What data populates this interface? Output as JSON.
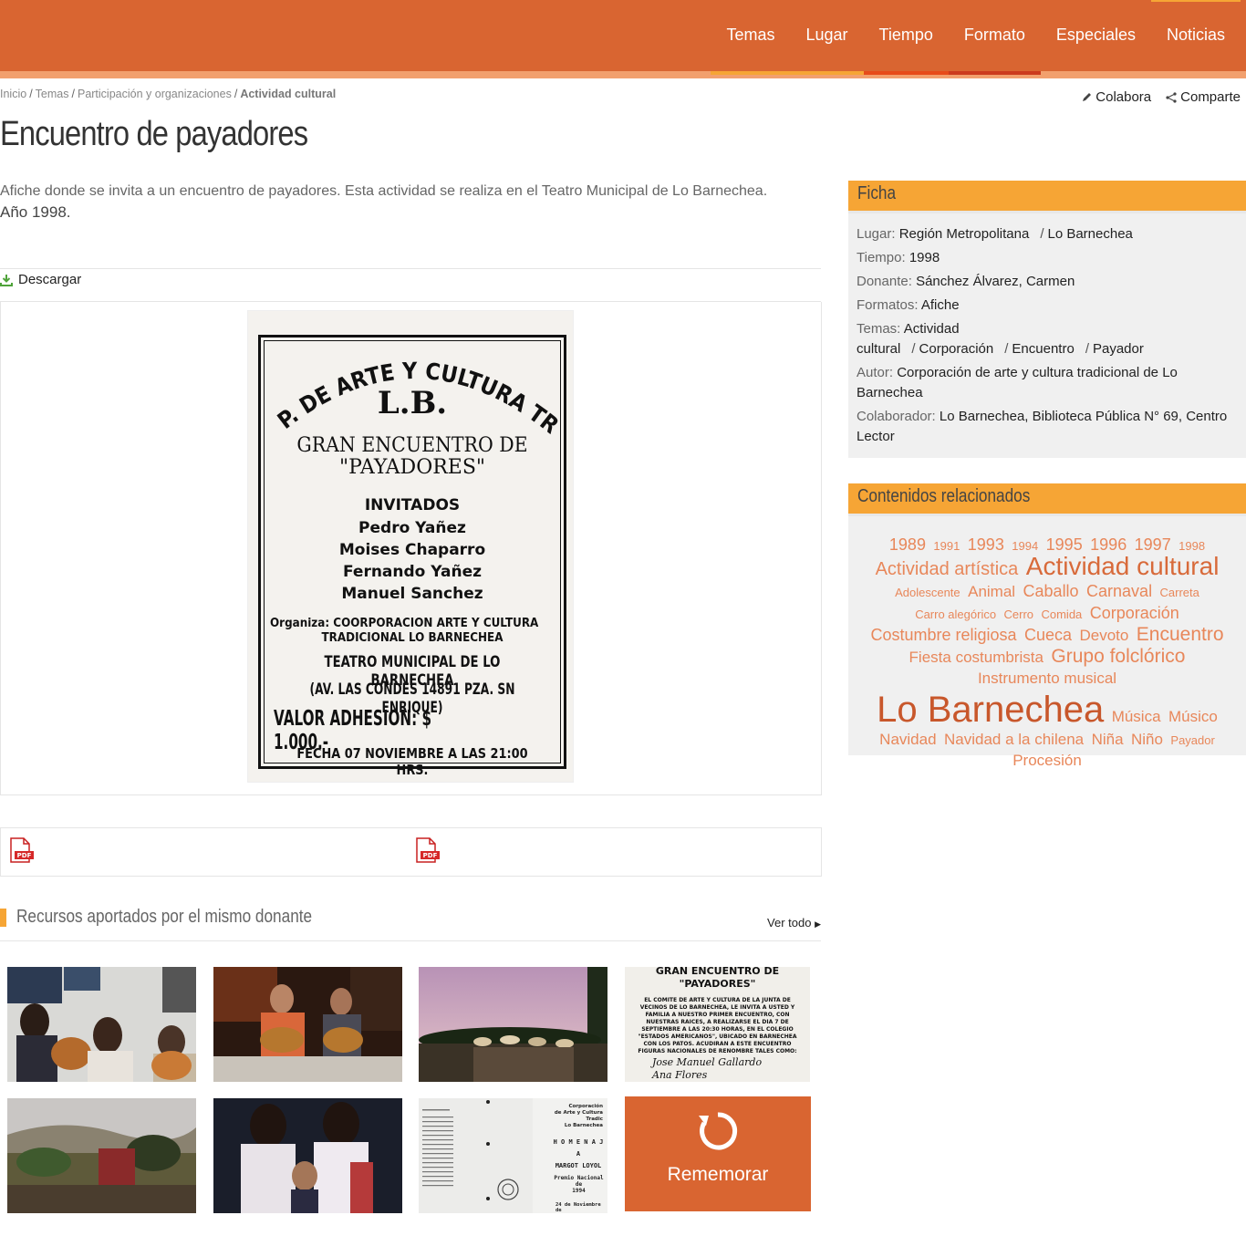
{
  "nav": {
    "items": [
      {
        "label": "Temas",
        "bar": "#f6a535"
      },
      {
        "label": "Lugar",
        "bar": "#f6a535"
      },
      {
        "label": "Tiempo",
        "bar": "#e74b1a"
      },
      {
        "label": "Formato",
        "bar": "#cc3b1e"
      },
      {
        "label": "Especiales",
        "bar": ""
      },
      {
        "label": "Noticias",
        "bar": ""
      }
    ]
  },
  "breadcrumb": {
    "items": [
      "Inicio",
      "Temas",
      "Participación y organizaciones"
    ],
    "current": "Actividad cultural"
  },
  "tools": {
    "collaborate": "Colabora",
    "share": "Comparte"
  },
  "page": {
    "title": "Encuentro de payadores",
    "description": "Afiche donde se invita a un encuentro de payadores. Esta actividad se realiza en el Teatro Municipal de Lo Barnechea.",
    "year": "Año 1998.",
    "download": "Descargar"
  },
  "poster": {
    "header": "CORP. DE ARTE Y CULTURA TRAD.",
    "lb": "L.B.",
    "title1": "GRAN ENCUENTRO DE",
    "title2": "\"PAYADORES\"",
    "guests_label": "INVITADOS",
    "guests": [
      "Pedro Yañez",
      "Moises Chaparro",
      "Fernando Yañez",
      "Manuel Sanchez"
    ],
    "organizer1": "Organiza: COORPORACION ARTE Y CULTURA",
    "organizer2": "TRADICIONAL LO BARNECHEA",
    "venue": "TEATRO MUNICIPAL DE LO BARNECHEA",
    "address": "(AV. LAS CONDES 14891 PZA. SN ENRIQUE)",
    "price": "VALOR ADHESION:  $ 1.000.-",
    "date": "FECHA 07 NOVIEMBRE A LAS 21:00 HRS."
  },
  "related_resources": {
    "title": "Recursos aportados por el mismo donante",
    "see_all": "Ver todo",
    "doc_thumb": {
      "title1": "GRAN ENCUENTRO DE",
      "title2": "\"PAYADORES\"",
      "body": "EL COMITE DE ARTE Y CULTURA DE LA JUNTA DE VECINOS DE LO BARNECHEA, LE INVITA A USTED Y FAMILIA A NUESTRO PRIMER ENCUENTRO, CON NUESTRAS RAICES, A REALIZARSE EL DIA 7 DE SEPTIEMBRE A LAS 20:30 HORAS, EN EL COLEGIO \"ESTADOS AMERICANOS\", UBICADO EN BARNECHEA CON LOS PATOS. ACUDIRAN A ESTE ENCUENTRO FIGURAS NACIONALES DE RENOMBRE TALES COMO:",
      "hand1": "Jose Manuel Gallardo",
      "hand2": "Ana Flores"
    },
    "doc_thumb2": {
      "h1": "Corporación",
      "h2": "de Arte y Cultura Tradic",
      "h3": "Lo Barnechea",
      "homenaje": "H O M E N A J",
      "a": "A",
      "name": "MARGOT LOYOL",
      "prize": "Premio Nacional de",
      "prize_year": "1994",
      "date": "24 de Noviembre de"
    },
    "remember": "Rememorar"
  },
  "ficha": {
    "title": "Ficha",
    "lugar_k": "Lugar:",
    "lugar": [
      "Región Metropolitana",
      "Lo Barnechea"
    ],
    "tiempo_k": "Tiempo:",
    "tiempo": "1998",
    "donante_k": "Donante:",
    "donante": "Sánchez Álvarez, Carmen",
    "formatos_k": "Formatos:",
    "formatos": "Afiche",
    "temas_k": "Temas:",
    "temas": [
      "Actividad cultural",
      "Corporación",
      "Encuentro",
      "Payador"
    ],
    "autor_k": "Autor:",
    "autor": "Corporación de arte y cultura tradicional de Lo Barnechea",
    "colaborador_k": "Colaborador:",
    "colaborador": "Lo Barnechea, Biblioteca Pública N° 69, Centro Lector"
  },
  "related": {
    "title": "Contenidos relacionados",
    "tags": [
      {
        "t": "1989",
        "s": 18
      },
      {
        "t": "1991",
        "s": 13
      },
      {
        "t": "1993",
        "s": 18
      },
      {
        "t": "1994",
        "s": 13
      },
      {
        "t": "1995",
        "s": 18
      },
      {
        "t": "1996",
        "s": 18
      },
      {
        "t": "1997",
        "s": 18
      },
      {
        "t": "1998",
        "s": 13
      },
      {
        "t": "Actividad artística",
        "s": 20
      },
      {
        "t": "Actividad cultural",
        "s": 28
      },
      {
        "t": "Adolescente",
        "s": 13
      },
      {
        "t": "Animal",
        "s": 17
      },
      {
        "t": "Caballo",
        "s": 18
      },
      {
        "t": "Carnaval",
        "s": 18
      },
      {
        "t": "Carreta",
        "s": 13
      },
      {
        "t": "Carro alegórico",
        "s": 13
      },
      {
        "t": "Cerro",
        "s": 13
      },
      {
        "t": "Comida",
        "s": 13
      },
      {
        "t": "Corporación",
        "s": 18
      },
      {
        "t": "Costumbre religiosa",
        "s": 18
      },
      {
        "t": "Cueca",
        "s": 18
      },
      {
        "t": "Devoto",
        "s": 17
      },
      {
        "t": "Encuentro",
        "s": 21
      },
      {
        "t": "Fiesta costumbrista",
        "s": 17
      },
      {
        "t": "Grupo folclórico",
        "s": 21
      },
      {
        "t": "Instrumento musical",
        "s": 17
      },
      {
        "t": "Lo Barnechea",
        "s": 40
      },
      {
        "t": "Música",
        "s": 17
      },
      {
        "t": "Músico",
        "s": 17
      },
      {
        "t": "Navidad",
        "s": 17
      },
      {
        "t": "Navidad a la chilena",
        "s": 17
      },
      {
        "t": "Niña",
        "s": 17
      },
      {
        "t": "Niño",
        "s": 17
      },
      {
        "t": "Payador",
        "s": 13
      },
      {
        "t": "Procesión",
        "s": 17
      }
    ]
  },
  "colors": {
    "brand": "#d96531",
    "accent": "#f6a535",
    "tag": "#e8875a"
  }
}
